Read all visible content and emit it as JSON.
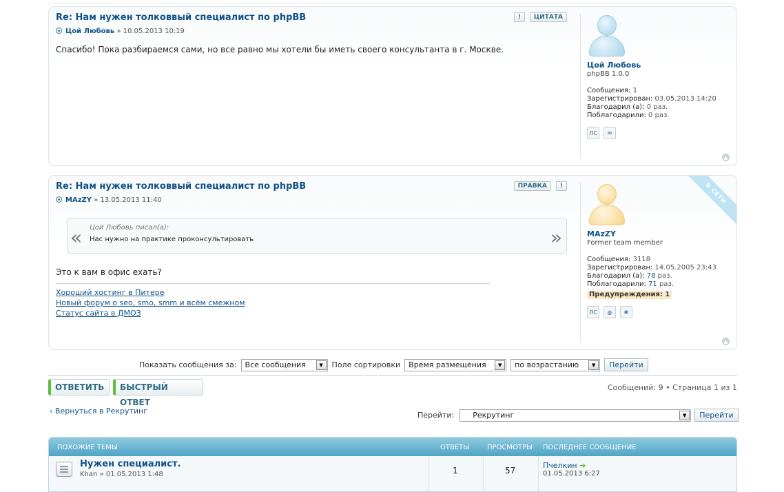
{
  "posts": [
    {
      "title": "Re: Нам нужен толковвый специалист по phpBB",
      "author": "Цой Любовь",
      "date": "» 10.05.2013 10:19",
      "buttons": [
        "!",
        "ЦИТАТА"
      ],
      "text": "Спасибо! Пока разбираемся сами, но все равно мы хотели бы иметь своего консультанта в г. Москве.",
      "profile": {
        "name": "Цой Любовь",
        "rank": "phpBB 1.0.0",
        "posts_label": "Сообщения:",
        "posts": "1",
        "reg_label": "Зарегистрирован:",
        "reg": "03.05.2013 14:20",
        "thanked_label": "Благодарил (а):",
        "thanked": "0 раз.",
        "got_label": "Поблагодарили:",
        "got": "0 раз.",
        "icons": [
          "ЛС",
          "✉"
        ]
      }
    },
    {
      "title": "Re: Нам нужен толковвый специалист по phpBB",
      "author": "MAzZY",
      "date": "» 13.05.2013 11:40",
      "buttons": [
        "ПРАВКА",
        "!"
      ],
      "ribbon": "В СЕТИ",
      "quote": {
        "cite": "Цой Любовь писал(а):",
        "text": "Нас нужно на практике проконсультировать"
      },
      "text": "Это к вам в офис ехать?",
      "signature": [
        "Хороший хостинг в Питере",
        "Новый форум о seo, smo, smm и всём смежном",
        "Статус сайта в ДМОЗ"
      ],
      "profile": {
        "name": "MAzZY",
        "rank": "Former team member",
        "posts_label": "Сообщения:",
        "posts": "3118",
        "reg_label": "Зарегистрирован:",
        "reg": "14.05.2005 23:43",
        "thanked_label": "Благодарил (а):",
        "thanked": "78",
        "thanked_unit": "раз.",
        "got_label": "Поблагодарили:",
        "got": "71",
        "got_unit": "раз.",
        "warn_label": "Предупреждения:",
        "warn": "1",
        "icons": [
          "ЛС",
          "◍",
          "❃"
        ]
      }
    }
  ],
  "sort": {
    "show_label": "Показать сообщения за:",
    "show_value": "Все сообщения",
    "sort_label": "Поле сортировки",
    "sort_value": "Время размещения",
    "order_value": "по возрастанию",
    "go": "Перейти"
  },
  "actions": {
    "reply": "ОТВЕТИТЬ",
    "quick_reply": "БЫСТРЫЙ ОТВЕТ"
  },
  "pagination": "Сообщений: 9 • Страница 1 из 1",
  "back": "‹ Вернуться в Рекрутинг",
  "jump": {
    "label": "Перейти:",
    "value": "Рекрутинг",
    "go": "Перейти"
  },
  "related": {
    "headers": {
      "topics": "ПОХОЖИЕ ТЕМЫ",
      "replies": "ОТВЕТЫ",
      "views": "ПРОСМОТРЫ",
      "last": "ПОСЛЕДНЕЕ СООБЩЕНИЕ"
    },
    "rows": [
      {
        "title": "Нужен специалист.",
        "sub": "Khan » 01.05.2013 1:48",
        "replies": "1",
        "views": "57",
        "last_author": "Пчелкин",
        "last_date": "01.05.2013 6:27"
      }
    ]
  }
}
